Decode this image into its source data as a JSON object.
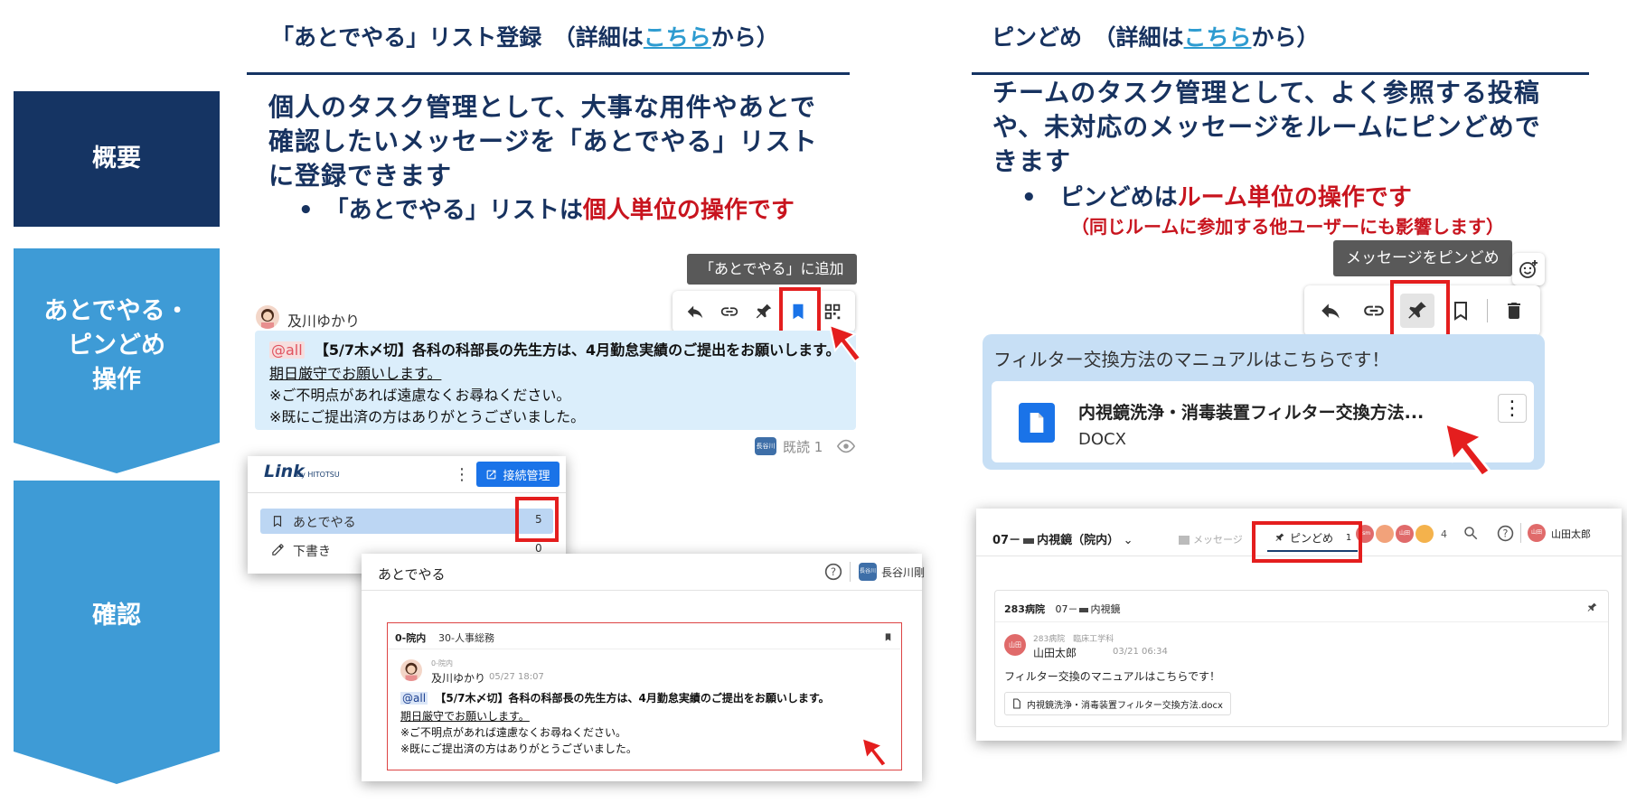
{
  "left_labels": {
    "overview": "概要",
    "operation_lines": [
      "あとでやる・",
      "ピンどめ",
      "操作"
    ],
    "confirm": "確認"
  },
  "left_header": {
    "prefix": "「あとでやる」リスト登録　（詳細は",
    "link": "こちら",
    "suffix": "から）"
  },
  "right_header": {
    "prefix": "ピンどめ　（詳細は",
    "link": "こちら",
    "suffix": "から）"
  },
  "left_desc": {
    "lines": [
      "個人のタスク管理として、大事な用件やあとで",
      "確認したいメッセージを「あとでやる」リスト",
      "に登録できます"
    ],
    "bullet_prefix": "•　「あとでやる」リストは",
    "bullet_emphasis": "個人単位の操作です"
  },
  "right_desc": {
    "lines": [
      "チームのタスク管理として、よく参照する投稿",
      "や、未対応のメッセージをルームにピンどめで",
      "きます"
    ],
    "bullet_prefix": "•　ピンどめは",
    "bullet_emphasis": "ルーム単位の操作です",
    "bullet_note": "（同じルームに参加する他ユーザーにも影響します）"
  },
  "left_op": {
    "tooltip": "「あとでやる」に追加",
    "sender": "及川ゆかり",
    "mention": "@all",
    "line1": "【5/7木〆切】各科の科部長の先生方は、4月勤怠実績のご提出をお願いします。",
    "line2": "期日厳守でお願いします。",
    "line3": "※ご不明点があれば遠慮なくお尋ねください。",
    "line4": "※既にご提出済の方はありがとうございました。",
    "read_avatar": "長谷川",
    "read_label": "既読 1"
  },
  "right_op": {
    "tooltip": "メッセージをピンどめ",
    "message": "フィルター交換方法のマニュアルはこちらです！",
    "file_name": "内視鏡洗浄・消毒装置フィルター交換方法...",
    "file_type": "DOCX"
  },
  "link_app": {
    "logo": "Link",
    "logo_sub": "by HITOTSU",
    "connect_button": "接続管理",
    "menu": [
      {
        "label": "あとでやる",
        "count": "5"
      },
      {
        "label": "下書き",
        "count": "0"
      }
    ]
  },
  "later_panel": {
    "title": "あとでやる",
    "user_avatar": "長谷川",
    "user_name": "長谷川剛",
    "room": "0-院内",
    "channel": "30-人事総務",
    "sender_meta": "0-院内",
    "sender": "及川ゆかり",
    "time": "05/27 18:07",
    "mention": "@all",
    "line1": "【5/7木〆切】各科の科部長の先生方は、4月勤怠実績のご提出をお願いします。",
    "line2": "期日厳守でお願いします。",
    "line3": "※ご不明点があれば遠慮なくお尋ねください。",
    "line4": "※既にご提出済の方はありがとうございました。"
  },
  "pin_panel": {
    "room_title": "07－",
    "room_name": "内視鏡（院内）",
    "tab_message": "メッセージ",
    "tab_pin": "ピンどめ",
    "pin_count": "1",
    "member_count": "4",
    "members": [
      "ssm",
      "",
      "山田",
      ""
    ],
    "user_avatar": "山田",
    "user_name": "山田太郎",
    "card_hospital": "283病院",
    "card_room": "07－",
    "card_room_name": "内視鏡",
    "sender_org": "283病院　臨床工学科",
    "sender": "山田太郎",
    "time": "03/21 06:34",
    "message": "フィルター交換のマニュアルはこちらです！",
    "file": "内視鏡洗浄・消毒装置フィルター交換方法.docx"
  },
  "colors": {
    "navy": "#153463",
    "blue": "#3e9bd6",
    "emphasis_red": "#c8141e",
    "highlight_red": "#e41e1e",
    "bubble": "#dbeefb",
    "link_blue": "#1a73e8"
  }
}
